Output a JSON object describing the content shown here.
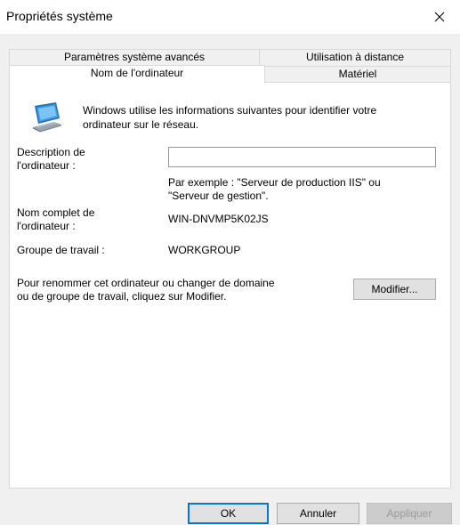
{
  "window": {
    "title": "Propriétés système",
    "close_glyph": "✕"
  },
  "tabs": {
    "row_back": [
      {
        "label": "Paramètres système avancés"
      },
      {
        "label": "Utilisation à distance"
      }
    ],
    "row_front": [
      {
        "label": "Nom de l'ordinateur",
        "selected": true
      },
      {
        "label": "Matériel",
        "selected": false
      }
    ]
  },
  "panel": {
    "icon": "computer-icon",
    "intro_line1": "Windows utilise les informations suivantes pour identifier votre",
    "intro_line2": "ordinateur sur le réseau.",
    "description_label_1": "Description de",
    "description_label_2": "l'ordinateur :",
    "description_value": "",
    "example_line1": "Par exemple : \"Serveur de production IIS\" ou",
    "example_line2": "\"Serveur de gestion\".",
    "fullname_label_1": "Nom complet de",
    "fullname_label_2": "l'ordinateur :",
    "fullname_value": "WIN-DNVMP5K02JS",
    "workgroup_label": "Groupe de travail :",
    "workgroup_value": "WORKGROUP",
    "rename_line1": "Pour renommer cet ordinateur ou changer de domaine",
    "rename_line2": "ou de groupe de travail, cliquez sur Modifier.",
    "modify_button": "Modifier..."
  },
  "footer": {
    "ok": "OK",
    "cancel": "Annuler",
    "apply": "Appliquer"
  },
  "colors": {
    "accent": "#0078d7",
    "input_border": "#7a9cc6"
  }
}
